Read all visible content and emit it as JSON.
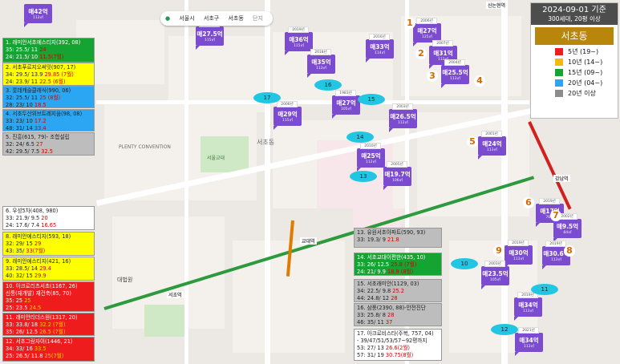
{
  "header": {
    "date": "2024-09-01 기준",
    "subtitle": "300세대, 20평 이상",
    "dong": "서초동",
    "legend": [
      {
        "label": "5년 (19~)",
        "color": "#ee1c1c"
      },
      {
        "label": "10년 (14~)",
        "color": "#f2b90f"
      },
      {
        "label": "15년 (09~)",
        "color": "#15a432"
      },
      {
        "label": "20년 (04~)",
        "color": "#2ba6f2"
      },
      {
        "label": "20년 이상",
        "color": "#8c8c8c"
      }
    ]
  },
  "search": {
    "items": [
      "서울시",
      "서초구",
      "서초동",
      "단지"
    ]
  },
  "colors": {
    "pin": "#7b4bd0",
    "oval": "#22c6e2",
    "rail": "#2c9a3d"
  },
  "map_labels": [
    "교대역",
    "서초역",
    "강남역",
    "서초동",
    "대법원",
    "서울교대",
    "PLENTY CONVENTION",
    "신논현역"
  ],
  "pins": [
    {
      "price": "매42억",
      "year": "",
      "size": "113㎡"
    },
    {
      "price": "매27.5억",
      "year": "2021년",
      "size": "115㎡"
    },
    {
      "price": "매36억",
      "year": "2019년",
      "size": "115㎡"
    },
    {
      "price": "매33억",
      "year": "2016년",
      "size": "114㎡"
    },
    {
      "price": "매27억",
      "year": "2006년",
      "size": "125㎡"
    },
    {
      "price": "매31억",
      "year": "2007년",
      "size": "112㎡"
    },
    {
      "price": "매35억",
      "year": "2018년",
      "size": "113㎡"
    },
    {
      "price": "매25.5억",
      "year": "2004년",
      "size": "113㎡"
    },
    {
      "price": "매27억",
      "year": "1983년",
      "size": "105㎡"
    },
    {
      "price": "매29억",
      "year": "2006년",
      "size": "115㎡"
    },
    {
      "price": "매26.5억",
      "year": "2003년",
      "size": "112㎡"
    },
    {
      "price": "매24억",
      "year": "2001년",
      "size": "113㎡"
    },
    {
      "price": "매25억",
      "year": "2010년",
      "size": "112㎡"
    },
    {
      "price": "매19.7억",
      "year": "2005년",
      "size": "106㎡"
    },
    {
      "price": "매17억",
      "year": "2019년",
      "size": "78㎡"
    },
    {
      "price": "매9.5억",
      "year": "2002년",
      "size": "84㎡"
    },
    {
      "price": "매30억",
      "year": "2019년",
      "size": "113㎡"
    },
    {
      "price": "매30.6억",
      "year": "2019년",
      "size": "113㎡"
    },
    {
      "price": "매23.5억",
      "year": "2003년",
      "size": "105㎡"
    },
    {
      "price": "매34억",
      "year": "2019년",
      "size": "113㎡"
    },
    {
      "price": "매34억",
      "year": "2021년",
      "size": "113㎡"
    }
  ],
  "numbers": [
    "1",
    "2",
    "3",
    "4",
    "5",
    "6",
    "7",
    "8",
    "9"
  ],
  "ovals": [
    "10",
    "11",
    "12",
    "13",
    "14",
    "15",
    "16",
    "17"
  ],
  "left_boxes": [
    {
      "cls": "green",
      "lines": [
        [
          "1. 래미안서초에스티지(392, 08)",
          ""
        ],
        [
          "35: 25.5/ 11 ",
          "24"
        ],
        [
          "24: 21.5/ 10 ",
          "11.5(7월)"
        ]
      ]
    },
    {
      "cls": "yellow",
      "lines": [
        [
          "2. 서초푸르지오써밋(907, 17)",
          ""
        ],
        [
          "34: 29.5/ 13.9 ",
          "29.85 (7월)"
        ],
        [
          "24: 23.9/ 11 ",
          "22.5 (6월)"
        ]
      ]
    },
    {
      "cls": "blue",
      "lines": [
        [
          "3. 롯데캐슬클래식(990, 06)",
          ""
        ],
        [
          "32: 25.5/ 11 ",
          "25 (8월)"
        ],
        [
          "28: 23/ 10 ",
          "18.5"
        ]
      ]
    },
    {
      "cls": "blue",
      "lines": [
        [
          "4. 서초두산위브트레지움(98, 08)",
          ""
        ],
        [
          "33: 23/ 10 ",
          "17.2"
        ],
        [
          "48: 31/ 14 ",
          "33.4"
        ]
      ]
    },
    {
      "cls": "gray",
      "lines": [
        [
          "5. 진흥(615, 79)- 조합설립",
          ""
        ],
        [
          "32: 24/ 6.5 ",
          "27"
        ],
        [
          "42: 29.5/ 7.5 ",
          "32.5"
        ]
      ]
    },
    {
      "cls": "white",
      "lines": [
        [
          "6. 우성5차(408, 980)",
          ""
        ],
        [
          "33: 21.9/ 9.5 ",
          "20"
        ],
        [
          "24: 17.6/ 7.4 ",
          "16.65"
        ]
      ]
    },
    {
      "cls": "yellow",
      "lines": [
        [
          "8. 래미안에스티지(593, 18)",
          ""
        ],
        [
          "32: 29/ 15 ",
          "29"
        ],
        [
          "43: 35/ ",
          "33(7월)"
        ]
      ]
    },
    {
      "cls": "yellow",
      "lines": [
        [
          "9. 래미안에스티지(421, 16)",
          ""
        ],
        [
          "33: 28.5/ 14 ",
          "29.4"
        ],
        [
          "40: 32/ 15 ",
          "29.9"
        ]
      ]
    },
    {
      "cls": "red",
      "lines": [
        [
          "10. 아크로리츠서초(1167, 26)",
          ""
        ],
        [
          "신통(재개발) 재건축(85, 70)",
          ""
        ],
        [
          "35: 25 ",
          "25"
        ],
        [
          "25: 23.5 ",
          "24.5"
        ]
      ]
    },
    {
      "cls": "red",
      "lines": [
        [
          "11. 래미안리더스원(1317, 20)",
          ""
        ],
        [
          "33: 33.8/ 18 ",
          "32.2 (7월)"
        ],
        [
          "35: 26/ 12.5 ",
          "26.5 (7월)"
        ]
      ]
    },
    {
      "cls": "red",
      "lines": [
        [
          "12. 서초그랑자이(1446, 21)",
          ""
        ],
        [
          "34: 33/ 16 ",
          "33.5"
        ],
        [
          "25: 26.5/ 11.8 ",
          "25(7월)"
        ]
      ]
    }
  ],
  "center_boxes": [
    {
      "cls": "gray",
      "lines": [
        [
          "13. 유원서초아파트(590, 93)",
          ""
        ],
        [
          "33: 19.3/ 9 ",
          "21.8"
        ]
      ]
    },
    {
      "cls": "green",
      "lines": [
        [
          "14. 서초교대이편한(435, 10)",
          ""
        ],
        [
          "33: 26/ 12.5 ",
          "25.8 (7월)"
        ],
        [
          "24: 21/ 9.9 ",
          "18.9 (8월)"
        ]
      ]
    },
    {
      "cls": "gray",
      "lines": [
        [
          "15. 서초래미안(1129, 03)",
          ""
        ],
        [
          "34: 22.5/ 9.8 ",
          "25.2"
        ],
        [
          "44: 24.8/ 12 ",
          "28"
        ]
      ]
    },
    {
      "cls": "gray",
      "lines": [
        [
          "16. 삼풍(2390, 88)-안전진단",
          ""
        ],
        [
          "33: 25.8/ 8 ",
          "28"
        ],
        [
          "46: 35/ 11 ",
          "37"
        ]
      ]
    },
    {
      "cls": "white",
      "lines": [
        [
          "17. 아크로비스타(주복, 757, 04)",
          ""
        ],
        [
          "- 39/47/51/53/57~92평까지",
          ""
        ],
        [
          "53: 27/ 13 ",
          "26.6(2월)"
        ],
        [
          "57: 31/ 19 ",
          "30.75(8월)"
        ]
      ]
    }
  ]
}
